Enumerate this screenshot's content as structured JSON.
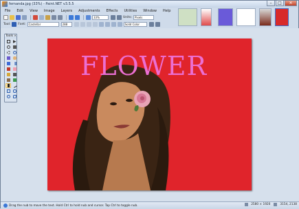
{
  "window": {
    "title": "fernanda.jpg (33%) - Paint.NET v3.5.5"
  },
  "menu": [
    "File",
    "Edit",
    "View",
    "Image",
    "Layers",
    "Adjustments",
    "Effects",
    "Utilities",
    "Window",
    "Help"
  ],
  "toolbar": {
    "zoom": "33%",
    "units_label": "Units:",
    "units_value": "Pixels",
    "tool_label": "Tool:",
    "font_label": "Font:",
    "font_value": "Castellar",
    "font_size": "288",
    "fill_value": "Solid Color"
  },
  "tools_panel": {
    "title": "Tools"
  },
  "canvas": {
    "text": "FLOWER",
    "background_color": "#e0242b",
    "text_color": "#ec6fd3"
  },
  "status": {
    "hint": "Drag the nub to move the text. Hold Ctrl to hold nub and cursor. Tap Ctrl to toggle nub.",
    "image_size": "2580 × 1920",
    "cursor_pos": "3154, 2138"
  }
}
